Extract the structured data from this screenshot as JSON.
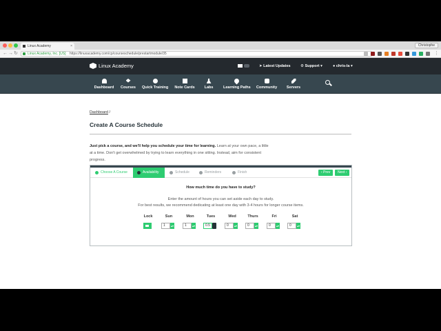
{
  "browser": {
    "tab_title": "Linux Academy",
    "profile_name": "Christophe",
    "url_secure_label": "Linux Academy, Inc. [US]",
    "url": "https://linuxacademy.com/cp/courseschedule/prestartmodule/35",
    "back": "←",
    "forward": "→",
    "reload": "↻",
    "close": "×"
  },
  "header": {
    "logo_text": "Linux Academy",
    "latest_updates": "Latest Updates",
    "support": "Support ▾",
    "user": "chris-la ▾"
  },
  "nav": {
    "items": [
      "Dashboard",
      "Courses",
      "Quick Training",
      "Note Cards",
      "Labs",
      "Learning Paths",
      "Community",
      "Servers"
    ]
  },
  "breadcrumb": {
    "link": "Dashboard",
    "sep": "/"
  },
  "page": {
    "title": "Create A Course Schedule",
    "intro_bold": "Just pick a course, and we'll help you schedule your time for learning.",
    "intro_rest": " Learn at your own pace, a little at a time. Don't get overwhelmed by trying to learn everything in one sitting. Instead, aim for consistent progress."
  },
  "wizard": {
    "steps": [
      "Choose A Course",
      "Availability",
      "Schedule",
      "Reminders",
      "Finish"
    ],
    "prev": "‹ Prev",
    "next": "Next ›",
    "question": "How much time do you have to study?",
    "hint_line1": "Enter the amount of hours you can set aside each day to study.",
    "hint_line2": "For best results, we recommend dedicating at least one day with 3-4 hours for longer course items.",
    "lock_label": "Lock",
    "days": [
      {
        "name": "Sun",
        "value": "1"
      },
      {
        "name": "Mon",
        "value": "1"
      },
      {
        "name": "Tues",
        "value": "0.5"
      },
      {
        "name": "Wed",
        "value": "0"
      },
      {
        "name": "Thurs",
        "value": "0"
      },
      {
        "name": "Fri",
        "value": "0"
      },
      {
        "name": "Sat",
        "value": "0"
      }
    ],
    "spin_glyph": "▴▾"
  },
  "colors": {
    "accent": "#2ecc71",
    "header_bg": "#24292e",
    "nav_bg": "#37474f"
  }
}
